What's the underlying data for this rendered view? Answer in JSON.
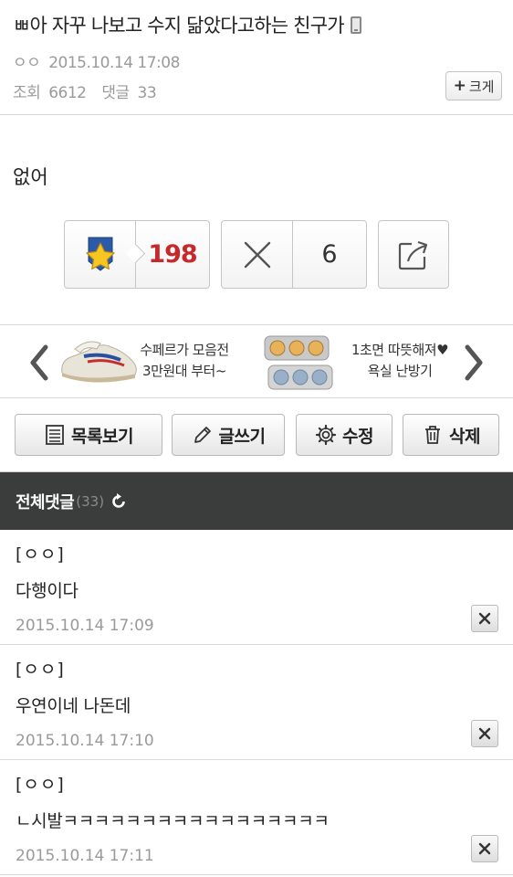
{
  "post": {
    "title": "ㅃ아 자꾸 나보고 수지 닮았다고하는 친구가",
    "author": "ㅇㅇ",
    "date": "2015.10.14 17:08",
    "views_label": "조회",
    "views": "6612",
    "comments_label": "댓글",
    "comments": "33",
    "enlarge_label": "크게",
    "content": "없어"
  },
  "votes": {
    "like_count": "198",
    "dislike_count": "6"
  },
  "ad": {
    "left_line1": "수페르가 모음전",
    "left_line2": "3만원대 부터~",
    "right_line1": "1초면 따뜻해져♥",
    "right_line2": "욕실 난방기"
  },
  "actions": {
    "list_label": "목록보기",
    "write_label": "글쓰기",
    "edit_label": "수정",
    "delete_label": "삭제"
  },
  "comments_section": {
    "title": "전체댓글",
    "count": "(33)",
    "items": [
      {
        "author": "[ㅇㅇ]",
        "text": "다행이다",
        "date": "2015.10.14 17:09"
      },
      {
        "author": "[ㅇㅇ]",
        "text": "우연이네 나돈데",
        "date": "2015.10.14 17:10"
      },
      {
        "author": "[ㅇㅇ]",
        "text": "ㄴ시발ㅋㅋㅋㅋㅋㅋㅋㅋㅋㅋㅋㅋㅋㅋㅋㅋㅋ",
        "date": "2015.10.14 17:11"
      }
    ]
  },
  "colors": {
    "like_count": "#c7282a",
    "comments_header_bg": "#3b3c3c",
    "star_fill": "#f7c623",
    "star_bg": "#2b5aa8",
    "meta_text": "#9a9a9a"
  }
}
